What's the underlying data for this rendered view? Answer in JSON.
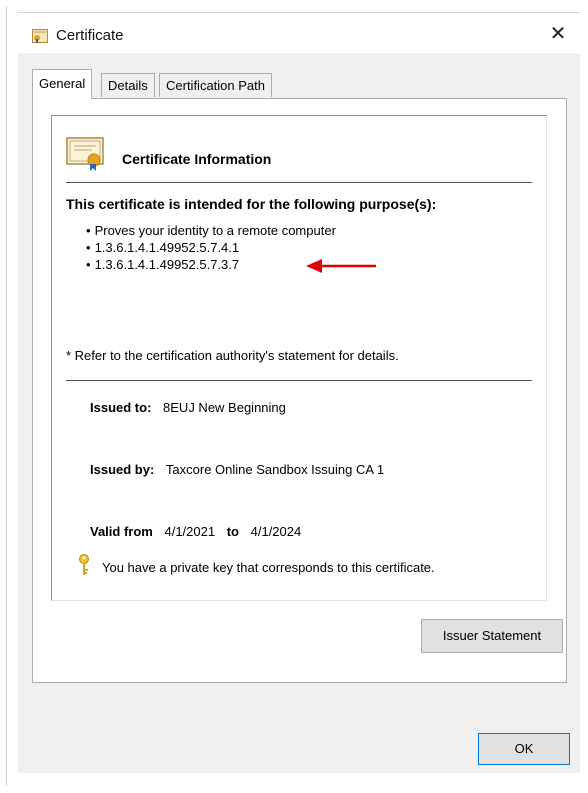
{
  "window": {
    "title": "Certificate",
    "close_glyph": "✕",
    "icon": "certificate-icon"
  },
  "tabs": [
    {
      "label": "General",
      "active": true
    },
    {
      "label": "Details",
      "active": false
    },
    {
      "label": "Certification Path",
      "active": false
    }
  ],
  "info": {
    "heading": "Certificate Information",
    "purpose_heading": "This certificate is intended for the following purpose(s):",
    "purposes": [
      "Proves your identity to a remote computer",
      "1.3.6.1.4.1.49952.5.7.4.1",
      "1.3.6.1.4.1.49952.5.7.3.7"
    ],
    "note": "* Refer to the certification authority's statement for details.",
    "issued_to_label": "Issued to:",
    "issued_to": "8EUJ New Beginning",
    "issued_by_label": "Issued by:",
    "issued_by": "Taxcore Online Sandbox Issuing CA 1",
    "valid_from_label": "Valid from",
    "valid_from": "4/1/2021",
    "to_label": "to",
    "valid_to": "4/1/2024",
    "private_key_note": "You have a private key that corresponds to this certificate."
  },
  "buttons": {
    "issuer_statement": "Issuer Statement",
    "ok": "OK"
  },
  "colors": {
    "arrow": "#e00000",
    "accent": "#0078d7"
  }
}
